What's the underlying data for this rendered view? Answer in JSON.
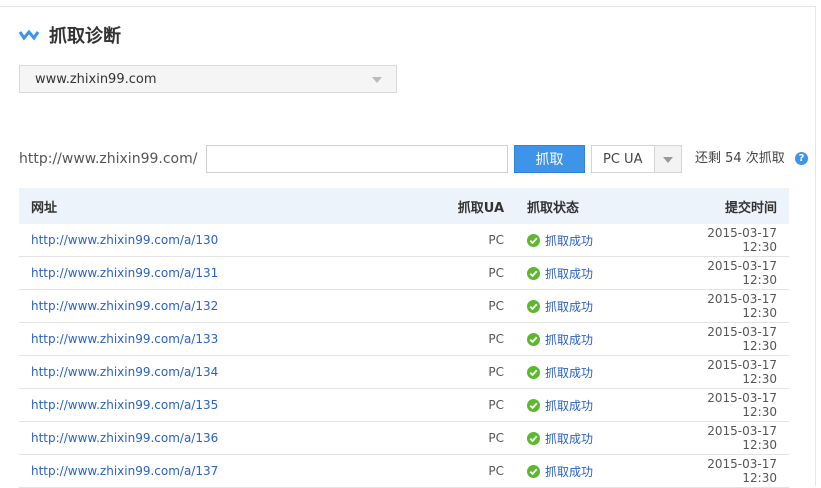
{
  "header": {
    "title": "抓取诊断"
  },
  "site_select": {
    "value": "www.zhixin99.com"
  },
  "fetch_form": {
    "url_prefix": "http://www.zhixin99.com/",
    "url_value": "",
    "fetch_button": "抓取",
    "ua_value": "PC UA",
    "remaining": "还剩 54 次抓取",
    "help_icon": "?"
  },
  "table": {
    "headers": {
      "url": "网址",
      "ua": "抓取UA",
      "status": "抓取状态",
      "time": "提交时间"
    },
    "rows": [
      {
        "url": "http://www.zhixin99.com/a/130",
        "ua": "PC",
        "status": "抓取成功",
        "time": "2015-03-17 12:30"
      },
      {
        "url": "http://www.zhixin99.com/a/131",
        "ua": "PC",
        "status": "抓取成功",
        "time": "2015-03-17 12:30"
      },
      {
        "url": "http://www.zhixin99.com/a/132",
        "ua": "PC",
        "status": "抓取成功",
        "time": "2015-03-17 12:30"
      },
      {
        "url": "http://www.zhixin99.com/a/133",
        "ua": "PC",
        "status": "抓取成功",
        "time": "2015-03-17 12:30"
      },
      {
        "url": "http://www.zhixin99.com/a/134",
        "ua": "PC",
        "status": "抓取成功",
        "time": "2015-03-17 12:30"
      },
      {
        "url": "http://www.zhixin99.com/a/135",
        "ua": "PC",
        "status": "抓取成功",
        "time": "2015-03-17 12:30"
      },
      {
        "url": "http://www.zhixin99.com/a/136",
        "ua": "PC",
        "status": "抓取成功",
        "time": "2015-03-17 12:30"
      },
      {
        "url": "http://www.zhixin99.com/a/137",
        "ua": "PC",
        "status": "抓取成功",
        "time": "2015-03-17 12:30"
      }
    ]
  },
  "colors": {
    "accent": "#3d94e8",
    "link": "#2a61c5",
    "success": "#5cb82c",
    "header_bg": "#ecf3fb"
  },
  "icons": {
    "title": "zigzag-icon",
    "status": "check-circle-icon",
    "help": "help-icon"
  }
}
